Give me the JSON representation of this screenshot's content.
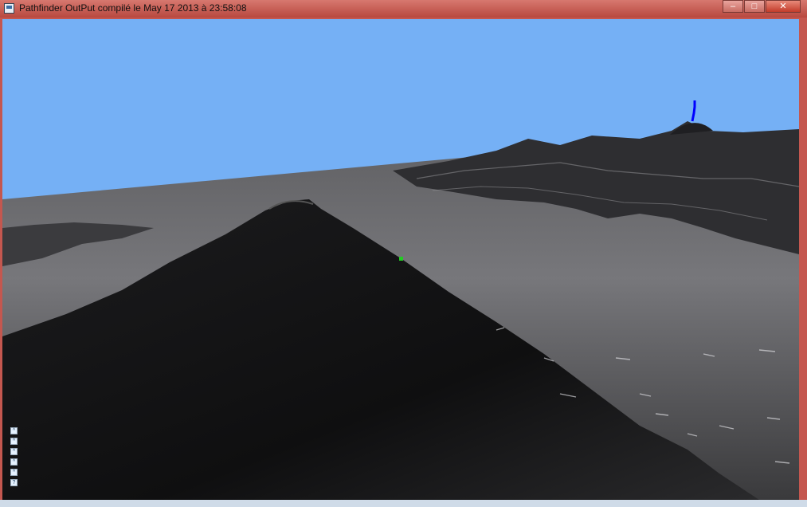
{
  "window": {
    "title": "Pathfinder OutPut compilé le May 17 2013 à 23:58:08",
    "controls": {
      "minimize": "–",
      "maximize": "□",
      "close": "✕"
    }
  },
  "viewport": {
    "sky_color": "#75b0f5",
    "terrain_color": "#2b2b2d",
    "path_color": "#0000ff",
    "marker_color": "#22cc22"
  },
  "hud": {
    "buttons": [
      "^",
      "^",
      "^",
      "^",
      "^",
      "?"
    ]
  }
}
